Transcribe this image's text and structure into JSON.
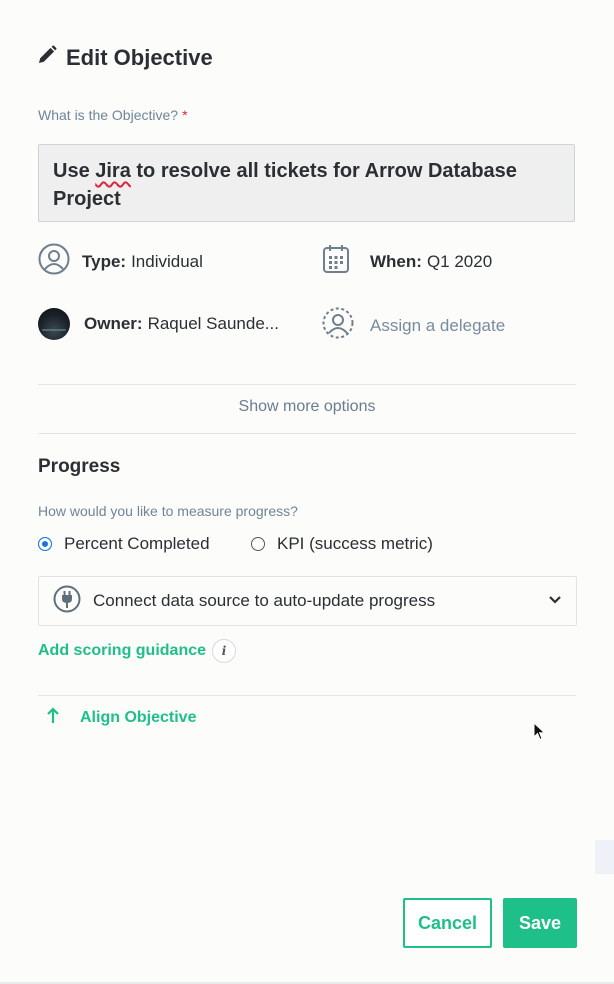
{
  "header": {
    "title": "Edit Objective",
    "icon": "pencil-icon"
  },
  "objective": {
    "question": "What is the Objective?",
    "required_marker": "*",
    "value_part1": "Use ",
    "value_misspelled": "Jira",
    "value_part2": " to resolve all tickets for Arrow Database Project"
  },
  "meta": {
    "type_label": "Type:",
    "type_value": "Individual",
    "when_label": "When:",
    "when_value": "Q1 2020",
    "owner_label": "Owner:",
    "owner_value": "Raquel Saunde...",
    "delegate_placeholder": "Assign a delegate"
  },
  "show_more": "Show more options",
  "progress": {
    "heading": "Progress",
    "question": "How would you like to measure progress?",
    "options": [
      {
        "label": "Percent Completed",
        "selected": true
      },
      {
        "label": "KPI (success metric)",
        "selected": false
      }
    ],
    "connect_label": "Connect data source to auto-update progress",
    "scoring_link": "Add scoring guidance",
    "info_glyph": "i"
  },
  "align": {
    "label": "Align Objective"
  },
  "footer": {
    "cancel_label": "Cancel",
    "save_label": "Save"
  },
  "colors": {
    "accent": "#1fbf8a",
    "label": "#6f8597",
    "required": "#e0243a",
    "radio": "#1a73e8"
  }
}
